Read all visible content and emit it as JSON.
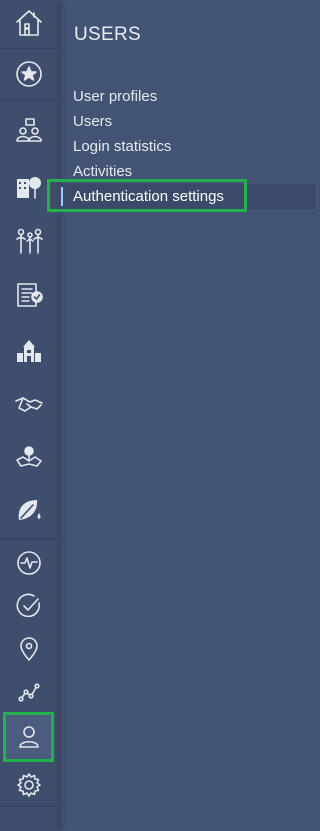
{
  "panel": {
    "title": "USERS",
    "items": [
      {
        "label": "User profiles",
        "selected": false
      },
      {
        "label": "Users",
        "selected": false
      },
      {
        "label": "Login statistics",
        "selected": false
      },
      {
        "label": "Activities",
        "selected": false
      },
      {
        "label": "Authentication settings",
        "selected": true
      }
    ]
  },
  "sidebar": {
    "icons": [
      "home-icon",
      "favorites-star-icon",
      "people-meeting-icon",
      "building-tree-icon",
      "family-icon",
      "checklist-document-icon",
      "town-buildings-icon",
      "handshake-icon",
      "map-location-icon",
      "leaf-water-icon",
      "activity-monitor-icon",
      "check-circle-icon",
      "location-pin-icon",
      "trend-line-icon",
      "user-icon",
      "settings-gear-icon"
    ],
    "active_icon": "user-icon"
  },
  "colors": {
    "background": "#435374",
    "rail": "#3f4e6d",
    "highlight": "#22b14c",
    "text": "#e6eaf0"
  }
}
